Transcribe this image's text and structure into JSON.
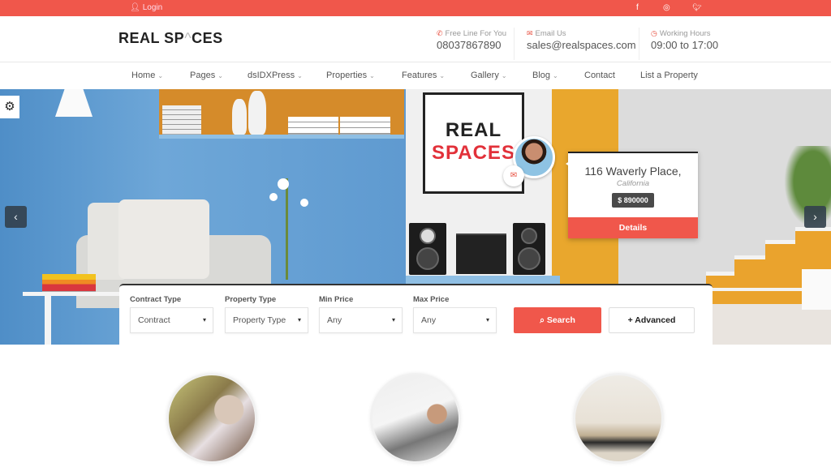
{
  "topbar": {
    "login_label": "Login",
    "login_icon": "user-icon",
    "social": [
      {
        "name": "facebook-icon",
        "glyph": "f"
      },
      {
        "name": "instagram-icon",
        "glyph": "◎"
      },
      {
        "name": "twitter-icon",
        "glyph": "🐦"
      }
    ]
  },
  "header": {
    "logo_part1": "REAL SP",
    "logo_accent": "^",
    "logo_part2": "CES",
    "contacts": [
      {
        "icon": "phone-icon",
        "glyph": "✆",
        "label": "Free Line For You",
        "value": "08037867890"
      },
      {
        "icon": "envelope-icon",
        "glyph": "✉",
        "label": "Email Us",
        "value": "sales@realspaces.com"
      },
      {
        "icon": "clock-icon",
        "glyph": "◷",
        "label": "Working Hours",
        "value": "09:00 to 17:00"
      }
    ]
  },
  "nav": {
    "items": [
      {
        "label": "Home",
        "dropdown": true
      },
      {
        "label": "Pages",
        "dropdown": true
      },
      {
        "label": "dsIDXPress",
        "dropdown": true
      },
      {
        "label": "Properties",
        "dropdown": true
      },
      {
        "label": "Features",
        "dropdown": true
      },
      {
        "label": "Gallery",
        "dropdown": true
      },
      {
        "label": "Blog",
        "dropdown": true
      },
      {
        "label": "Contact",
        "dropdown": false
      },
      {
        "label": "List a Property",
        "dropdown": false
      }
    ],
    "caret": "⌄"
  },
  "hero": {
    "frame_line1": "REAL",
    "frame_line2": "SPACES",
    "mail_glyph": "✉",
    "gear_glyph": "⚙",
    "prev_glyph": "‹",
    "next_glyph": "›",
    "property": {
      "address": "116 Waverly Place,",
      "city": "California",
      "price": "$   890000",
      "details_label": "Details"
    }
  },
  "search": {
    "fields": [
      {
        "label": "Contract Type",
        "value": "Contract"
      },
      {
        "label": "Property Type",
        "value": "Property Type"
      },
      {
        "label": "Min Price",
        "value": "Any"
      },
      {
        "label": "Max Price",
        "value": "Any"
      }
    ],
    "caret": "▾",
    "search_label": "⌕ Search",
    "advanced_label": "+ Advanced"
  },
  "features": {
    "images": [
      "woman-with-laptop-image",
      "business-meeting-image",
      "living-room-image"
    ]
  }
}
